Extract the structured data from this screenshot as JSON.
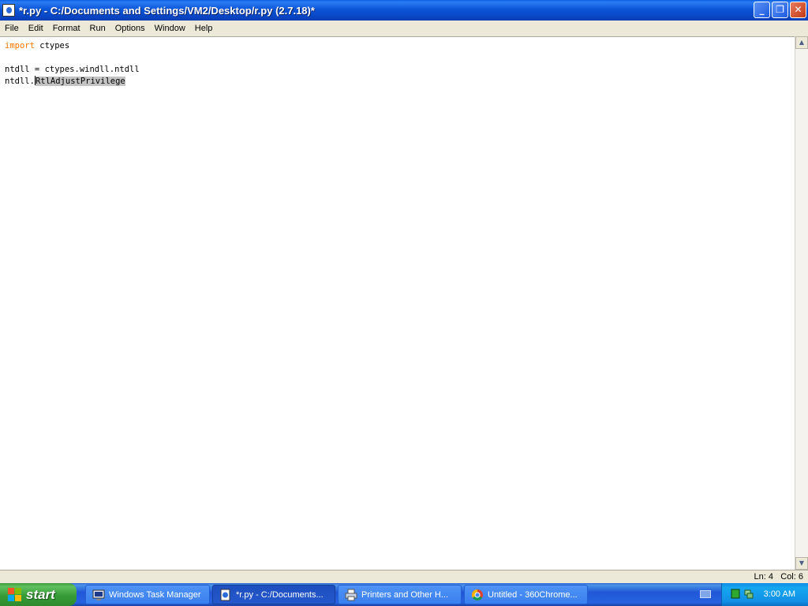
{
  "window": {
    "title": "*r.py - C:/Documents and Settings/VM2/Desktop/r.py (2.7.18)*",
    "minimize": "_",
    "maximize": "❐",
    "close": "✕"
  },
  "menu": {
    "items": [
      "File",
      "Edit",
      "Format",
      "Run",
      "Options",
      "Window",
      "Help"
    ]
  },
  "editor": {
    "line1_keyword": "import",
    "line1_rest": " ctypes",
    "line3": "ntdll = ctypes.windll.ntdll",
    "line4_prefix": "ntdll.",
    "line4_selected": "RtlAdjustPrivilege",
    "keyword_color": "#ff7700",
    "selection_color": "#c3c3c3"
  },
  "status": {
    "line": "Ln: 4",
    "col": "Col: 6"
  },
  "taskbar": {
    "start_label": "start",
    "tasks": [
      {
        "label": "Windows Task Manager",
        "icon": "task-manager-icon"
      },
      {
        "label": "*r.py - C:/Documents...",
        "icon": "python-idle-icon"
      },
      {
        "label": "Printers and Other H...",
        "icon": "printer-icon"
      },
      {
        "label": "Untitled - 360Chrome...",
        "icon": "chrome-icon"
      }
    ],
    "clock": "3:00 AM"
  }
}
